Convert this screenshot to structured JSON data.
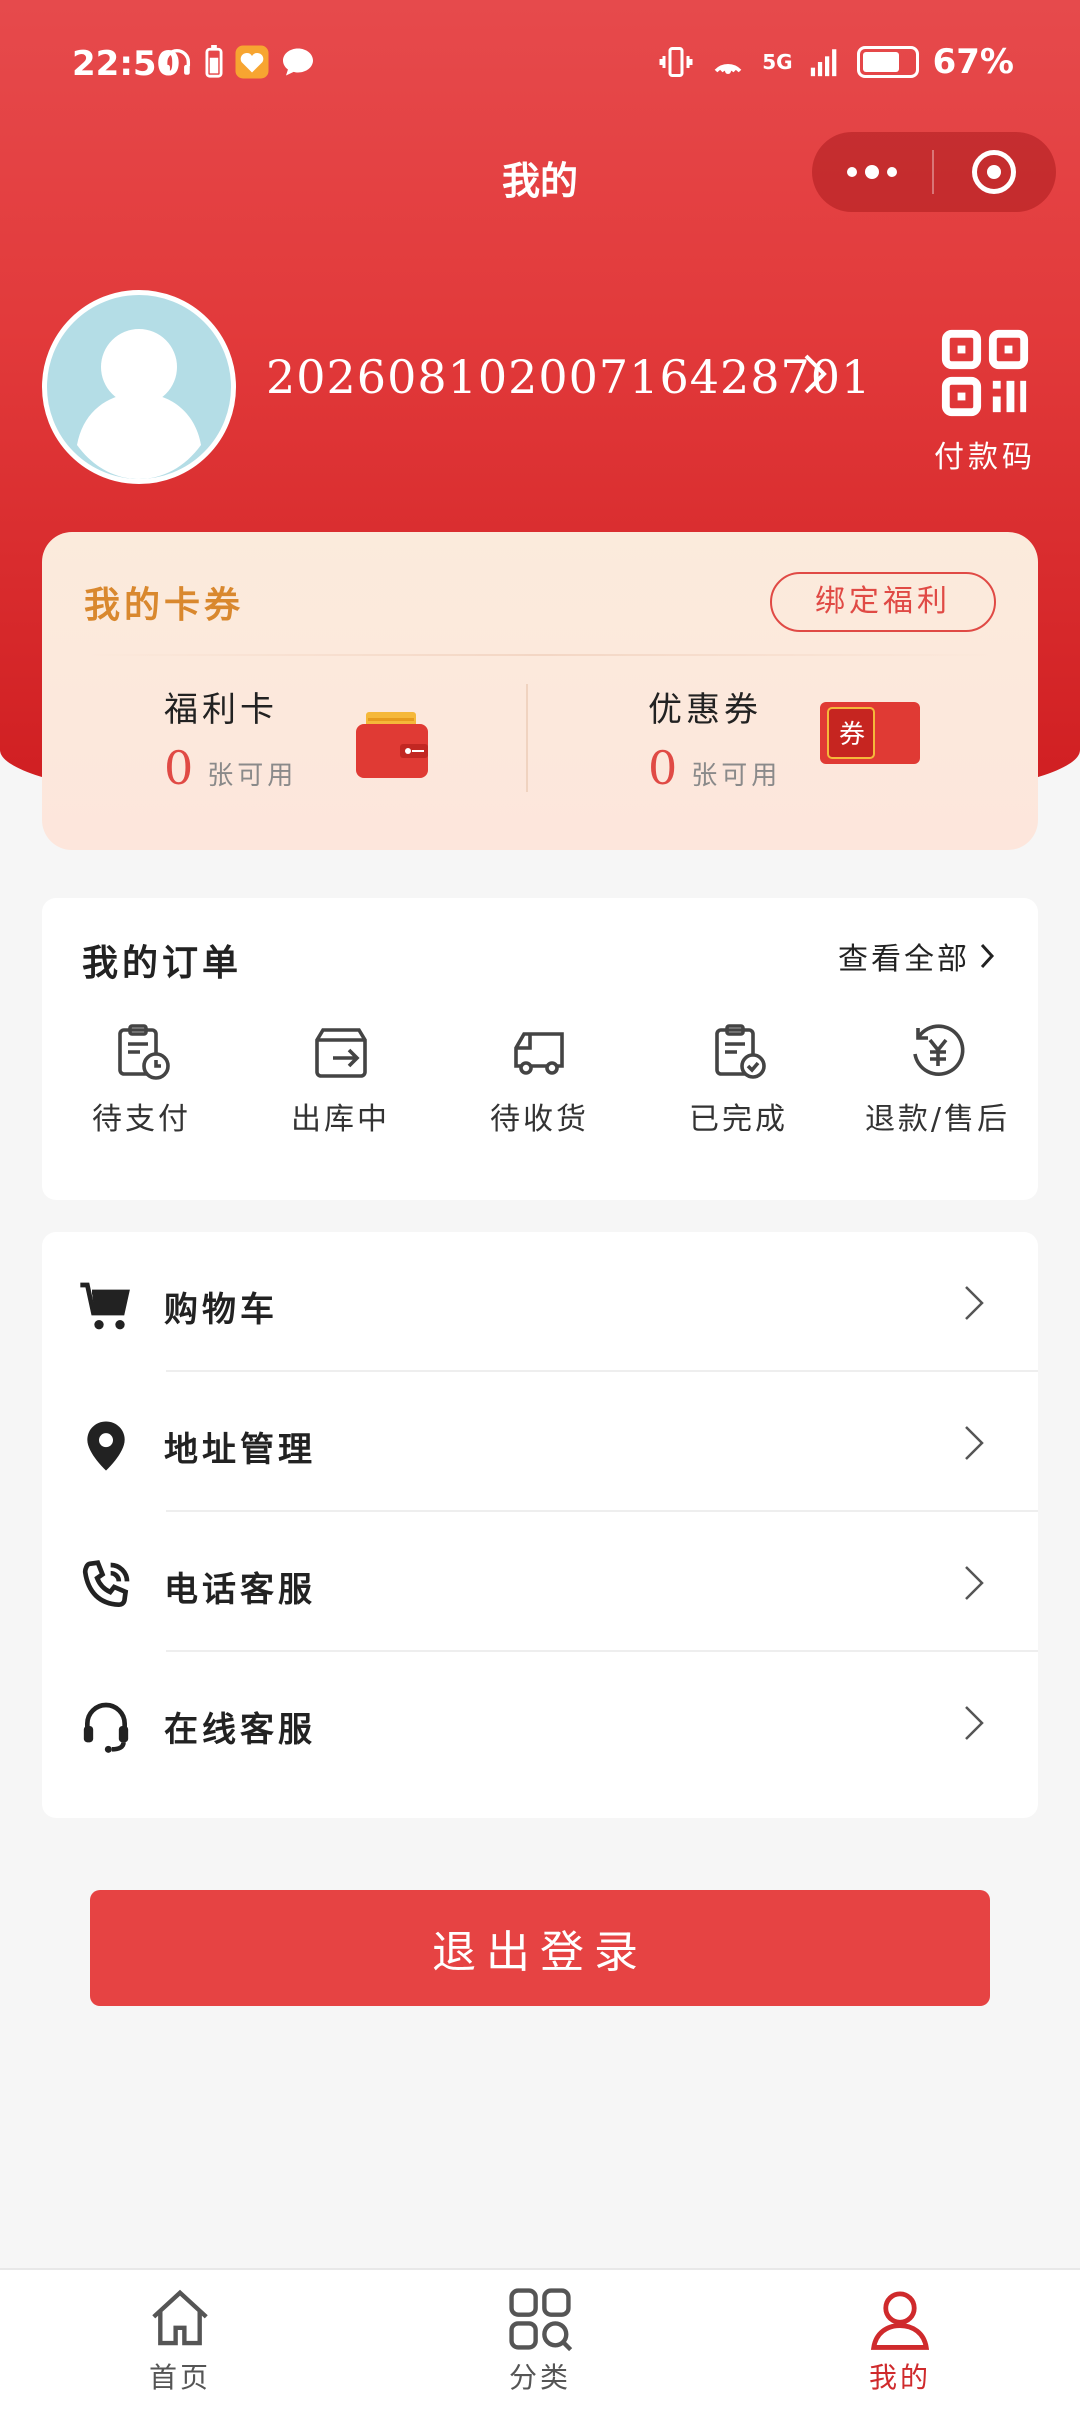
{
  "status_bar": {
    "time": "22:50",
    "network": "5G",
    "battery": "67%"
  },
  "nav": {
    "title": "我的"
  },
  "profile": {
    "user_id": "20260810200716428701",
    "paycode_label": "付款码"
  },
  "coupons": {
    "title": "我的卡券",
    "bind_label": "绑定福利",
    "items": [
      {
        "name": "福利卡",
        "count": "0",
        "unit": "张可用"
      },
      {
        "name": "优惠券",
        "count": "0",
        "unit": "张可用",
        "badge": "券"
      }
    ]
  },
  "orders": {
    "title": "我的订单",
    "view_all": "查看全部",
    "items": [
      {
        "label": "待支付",
        "icon": "clipboard-clock-icon"
      },
      {
        "label": "出库中",
        "icon": "box-out-icon"
      },
      {
        "label": "待收货",
        "icon": "truck-icon"
      },
      {
        "label": "已完成",
        "icon": "clipboard-check-icon"
      },
      {
        "label": "退款/售后",
        "icon": "refund-yen-icon"
      }
    ]
  },
  "menu": {
    "items": [
      {
        "label": "购物车",
        "icon": "cart-icon"
      },
      {
        "label": "地址管理",
        "icon": "location-pin-icon"
      },
      {
        "label": "电话客服",
        "icon": "phone-icon"
      },
      {
        "label": "在线客服",
        "icon": "headset-icon"
      }
    ]
  },
  "logout_label": "退出登录",
  "tabbar": {
    "items": [
      {
        "label": "首页",
        "icon": "home-icon",
        "active": false
      },
      {
        "label": "分类",
        "icon": "category-icon",
        "active": false
      },
      {
        "label": "我的",
        "icon": "user-icon",
        "active": true
      }
    ]
  },
  "colors": {
    "brand_red": "#e23a3b",
    "coupon_gold": "#d9882e",
    "active_tab": "#cf2a2c"
  }
}
